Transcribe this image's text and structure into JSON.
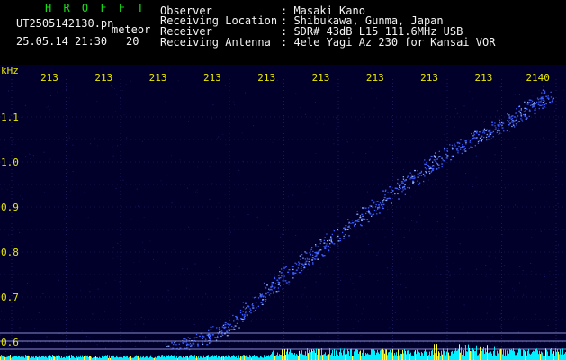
{
  "header": {
    "brand": "H R O F F T",
    "filename": "UT2505142130.pn",
    "mode_tag": "meteor",
    "datetime": "25.05.14 21:30",
    "tail_value": "20",
    "observer_label": "Observer",
    "observer_value": ": Masaki Kano",
    "location_label": "Receiving Location",
    "location_value": ": Shibukawa, Gunma, Japan",
    "receiver_label": "Receiver",
    "receiver_value": ": SDR# 43dB L15 111.6MHz USB",
    "antenna_label": "Receiving Antenna",
    "antenna_value": ": 4ele Yagi Az 230 for Kansai VOR"
  },
  "plot": {
    "y_unit": "kHz",
    "x_tick_labels": [
      "213",
      "213",
      "213",
      "213",
      "213",
      "213",
      "213",
      "213",
      "213",
      "2140"
    ],
    "y_ticks": [
      1.1,
      1.0,
      0.9,
      0.8,
      0.7,
      0.6
    ],
    "y_tick_labels": [
      "1.1",
      "1.0",
      "0.9",
      "0.8",
      "0.7",
      "0.6"
    ],
    "colors": {
      "background": "#00002a",
      "signal": "#3a5cff",
      "signal_bright": "#8fb0ff",
      "noise_floor": "#00f0ff",
      "axis_text": "#e8e800",
      "reference_lines": "#8a8ad0"
    },
    "trace": {
      "description_points_time_freq": [
        [
          0.3,
          0.585
        ],
        [
          0.4,
          0.63
        ],
        [
          0.5,
          0.745
        ],
        [
          0.6,
          0.84
        ],
        [
          0.7,
          0.94
        ],
        [
          0.8,
          1.03
        ],
        [
          0.9,
          1.09
        ],
        [
          0.97,
          1.15
        ]
      ]
    }
  }
}
